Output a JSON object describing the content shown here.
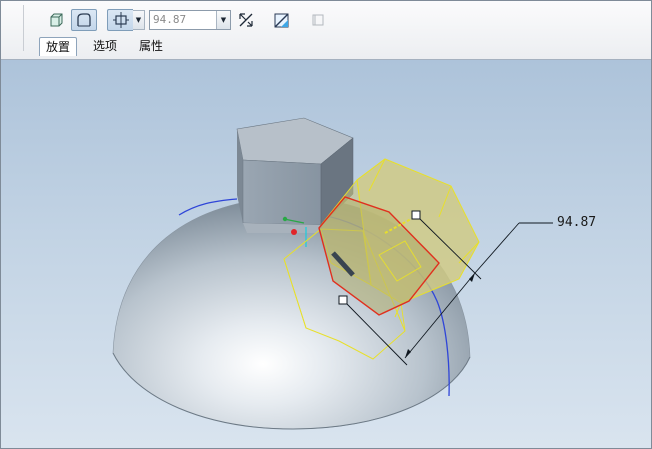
{
  "dashboard": {
    "toolbar": {
      "solid_icon": "solid-cube-icon",
      "surface_icon": "surface-icon",
      "depth_option_icon": "blind-depth-icon",
      "depth_value": "94.87",
      "flip_direction_icon": "flip-direction-icon",
      "remove_material_icon": "remove-material-icon",
      "thicken_icon": "thicken-icon"
    },
    "tabs": [
      {
        "label": "放置"
      },
      {
        "label": "选项"
      },
      {
        "label": "属性"
      }
    ]
  },
  "viewport": {
    "dimension_label": "94.87",
    "colors": {
      "preview_outline": "#e8e02a",
      "preview_fill": "#b9b56a",
      "sketch_edge": "#e0301e",
      "curve": "#2f45d8",
      "dimension_line": "#101820",
      "dome": "#b3bec8"
    }
  }
}
